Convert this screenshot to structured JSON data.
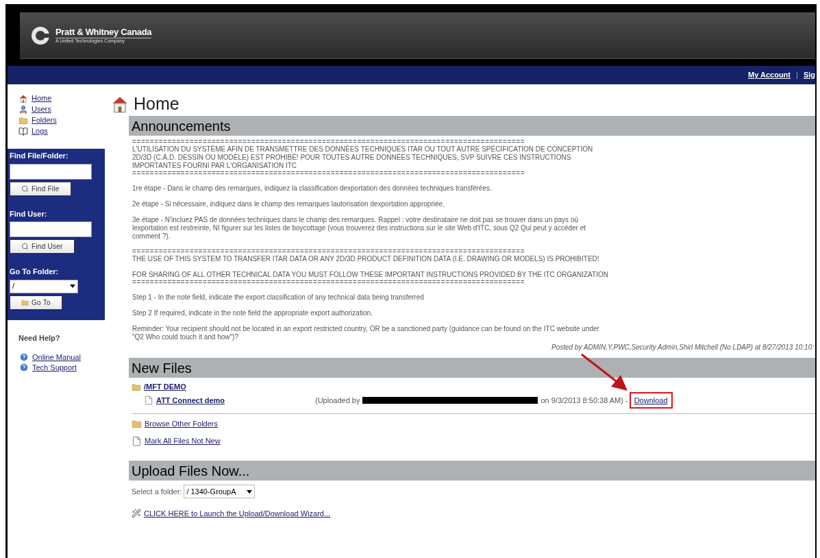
{
  "header": {
    "logo_name": "Pratt & Whitney Canada",
    "logo_tagline": "A United Technologies Company"
  },
  "top_links": [
    {
      "kind": "link",
      "text": "My Account"
    },
    {
      "kind": "separator",
      "text": "|"
    },
    {
      "kind": "link",
      "text": "Sig"
    }
  ],
  "sidebar": {
    "nav": [
      {
        "label": "Home"
      },
      {
        "label": "Users"
      },
      {
        "label": "Folders"
      },
      {
        "label": "Logs"
      }
    ],
    "find_file": {
      "label": "Find File/Folder:",
      "button": "Find File"
    },
    "find_user": {
      "label": "Find User:",
      "button": "Find User"
    },
    "go_to_folder": {
      "label": "Go To Folder:",
      "value": "/",
      "button": "Go To"
    },
    "help": {
      "title": "Need Help?",
      "links": [
        "Online Manual",
        "Tech Support"
      ]
    }
  },
  "page_title": "Home",
  "announcements": {
    "title": "Announcements",
    "sections": [
      [
        {
          "kind": "rule",
          "text": "========================================================================================="
        },
        {
          "kind": "para",
          "text": "L'UTILISATION DU SYSTÈME AFIN DE TRANSMETTRE DES DONNÉES TECHNIQUES ITAR OU TOUT AUTRE SPÉCIFICATION DE CONCEPTION 2D/3D (C.À.D. DESSIN OU MODÈLE) EST PROHIBÉ! POUR TOUTES AUTRE DONNÉES TECHNIQUES, SVP SUIVRE CES INSTRUCTIONS IMPORTANTES FOURNI PAR L'ORGANISATION ITC"
        },
        {
          "kind": "rule",
          "text": "========================================================================================="
        }
      ],
      [
        {
          "kind": "para",
          "text": "1re étape - Dans le champ des remarques, indiquez la classification dexportation des données techniques transférées."
        }
      ],
      [
        {
          "kind": "para",
          "text": "2e étape - Si nécessaire, indiquez dans le champ des remarques lautorisation dexportation appropriée."
        }
      ],
      [
        {
          "kind": "para",
          "text": "3e étape - N'incluez PAS de données techniques dans le champ des remarques. Rappel : votre destinataire ne doit pas se trouver dans un pays où lexportation est restreinte, NI figurer sur les listes de boycottage (vous trouverez des instructions sur le site Web d'ITC, sous Q2 Qui peut y accéder et comment ?)."
        }
      ],
      [
        {
          "kind": "rule",
          "text": "========================================================================================="
        },
        {
          "kind": "para",
          "text": "THE USE OF THIS SYSTEM TO TRANSFER ITAR DATA OR ANY 2D/3D PRODUCT DEFINITION DATA (I.E. DRAWING OR MODELS) IS PROHIBITED!"
        }
      ],
      [
        {
          "kind": "para",
          "text": "FOR SHARING OF ALL OTHER TECHNICAL DATA YOU MUST FOLLOW THESE IMPORTANT INSTRUCTIONS PROVIDED BY THE ITC ORGANIZATION"
        },
        {
          "kind": "rule",
          "text": "========================================================================================="
        }
      ],
      [
        {
          "kind": "para",
          "text": "Step 1 - In the note field, indicate the export classification of any technical data being transferred"
        }
      ],
      [
        {
          "kind": "para",
          "text": "Step 2 If required, indicate in the note field the appropriate export authorization."
        }
      ],
      [
        {
          "kind": "para",
          "text": "Reminder: Your recipient should not be located in an export restricted country, OR be a sanctioned party (guidance can be found on the ITC website under \"Q2 Who could touch it and how\")?"
        }
      ]
    ],
    "posted_by": "Posted by ADMIN,Y,PWC,Security Admin,Shirl Mitchell (No LDAP) at 8/27/2013 10:10:"
  },
  "new_files": {
    "title": "New Files",
    "folder": "/MFT DEMO",
    "files": [
      {
        "name": "ATT Connect demo",
        "uploaded_prefix": "(Uploaded by",
        "uploaded_suffix": "on 9/3/2013 8:50:38 AM) -",
        "action": "Download",
        "highlighted": true
      }
    ],
    "links": [
      {
        "label": "Browse Other Folders"
      },
      {
        "label": "Mark All Files Not New"
      }
    ]
  },
  "upload": {
    "title": "Upload Files Now...",
    "select_label": "Select a folder:",
    "select_value": "/ 1340-GroupA",
    "wizard_link": "CLICK HERE to Launch the Upload/Download Wizard..."
  }
}
